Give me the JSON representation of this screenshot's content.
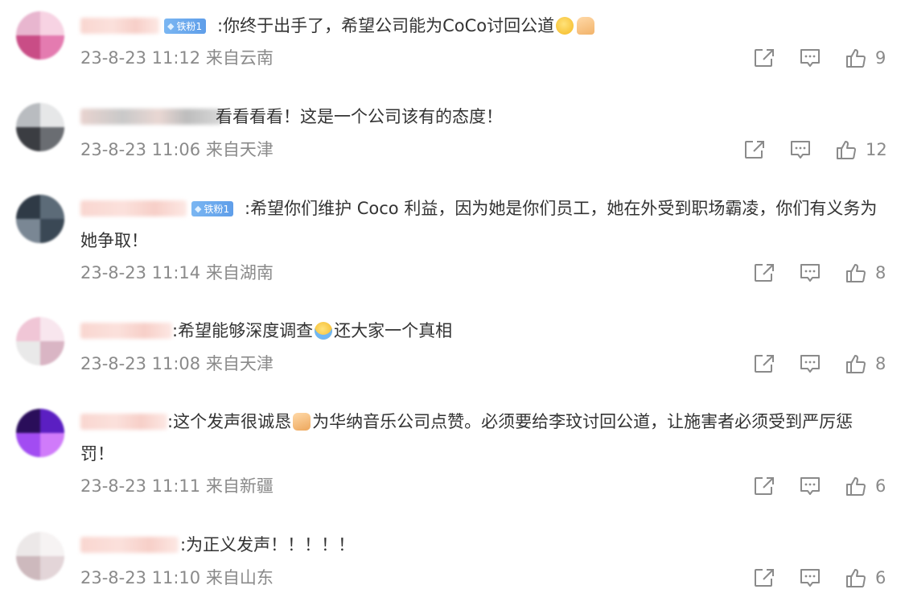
{
  "badge_label": "铁粉1",
  "comments": [
    {
      "text": ":你终于出手了，希望公司能为CoCo讨回公道",
      "time": "23-8-23 11:12",
      "location": "来自云南",
      "likes": "9"
    },
    {
      "text": "看看看看！这是一个公司该有的态度！",
      "time": "23-8-23 11:06",
      "location": "来自天津",
      "likes": "12"
    },
    {
      "text": ":希望你们维护 Coco 利益，因为她是你们员工，她在外受到职场霸凌，你们有义务为她争取！",
      "time": "23-8-23 11:14",
      "location": "来自湖南",
      "likes": "8"
    },
    {
      "text_a": ":希望能够深度调查",
      "text_b": "还大家一个真相",
      "time": "23-8-23 11:08",
      "location": "来自天津",
      "likes": "8"
    },
    {
      "text_a": ":这个发声很诚恳",
      "text_b": "为华纳音乐公司点赞。必须要给李玟讨回公道，让施害者必须受到严厉惩罚！",
      "time": "23-8-23 11:11",
      "location": "来自新疆",
      "likes": "6"
    },
    {
      "text": ":为正义发声！！！！！",
      "time": "23-8-23 11:10",
      "location": "来自山东",
      "likes": "6"
    }
  ],
  "icons": {
    "share": "share-icon",
    "reply": "comment-icon",
    "like": "thumbs-up-icon"
  },
  "colors": {
    "text": "#333333",
    "meta": "#8a8a8a",
    "badge": "#6aa8ee"
  }
}
